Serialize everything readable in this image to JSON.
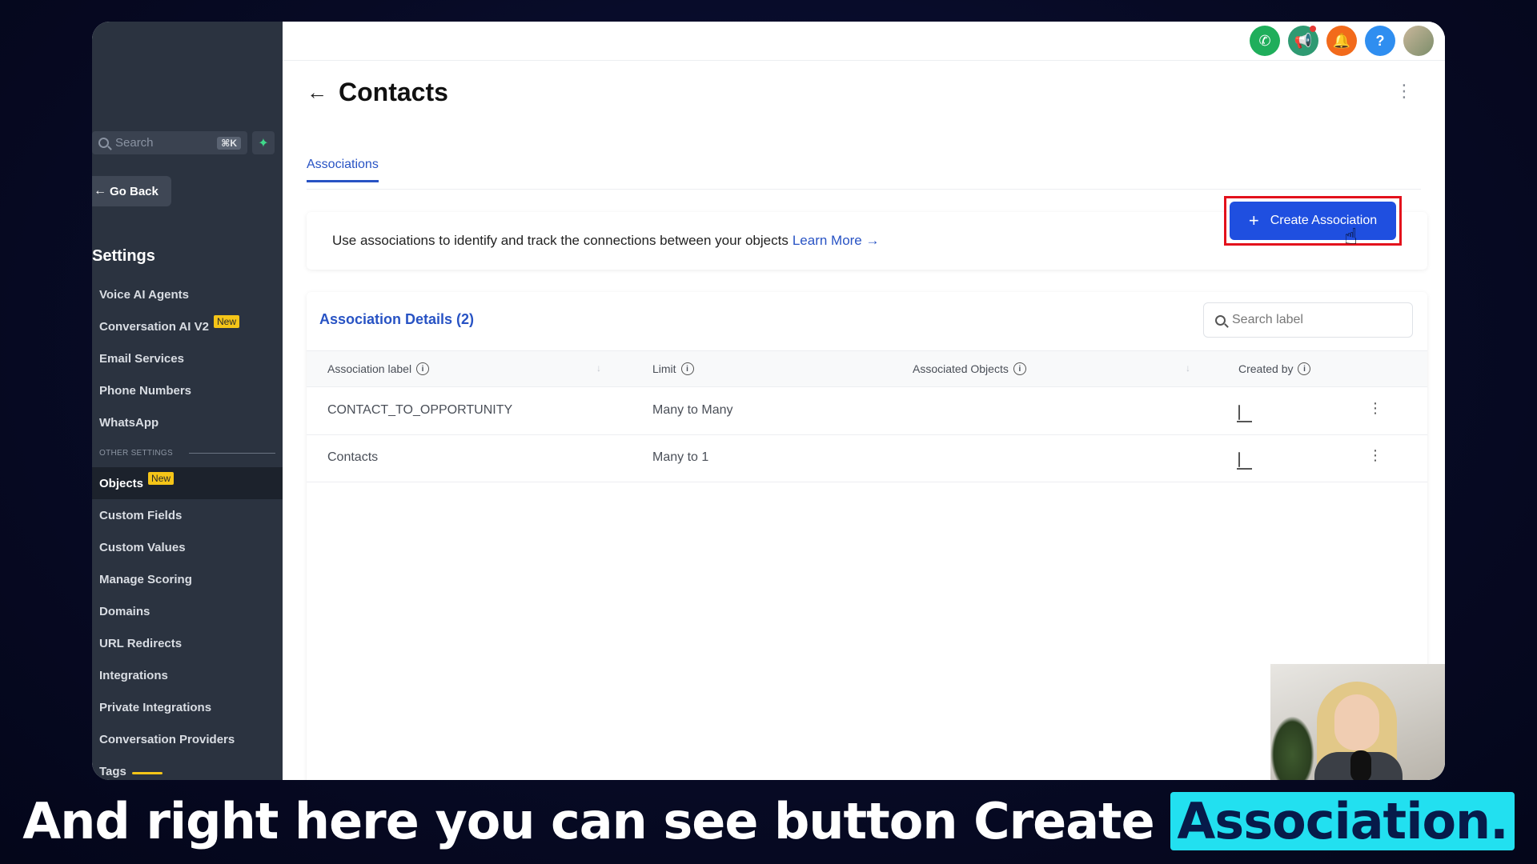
{
  "sidebar": {
    "search_placeholder": "Search",
    "search_shortcut": "⌘K",
    "go_back": "Go Back",
    "title": "Settings",
    "items": [
      {
        "label": "Voice AI Agents",
        "badge": ""
      },
      {
        "label": "Conversation AI V2",
        "badge": "New"
      },
      {
        "label": "Email Services",
        "badge": ""
      },
      {
        "label": "Phone Numbers",
        "badge": ""
      },
      {
        "label": "WhatsApp",
        "badge": ""
      }
    ],
    "section_label": "OTHER SETTINGS",
    "other_items": [
      {
        "label": "Objects",
        "badge": "New",
        "active": true
      },
      {
        "label": "Custom Fields",
        "badge": ""
      },
      {
        "label": "Custom Values",
        "badge": ""
      },
      {
        "label": "Manage Scoring",
        "badge": ""
      },
      {
        "label": "Domains",
        "badge": ""
      },
      {
        "label": "URL Redirects",
        "badge": ""
      },
      {
        "label": "Integrations",
        "badge": ""
      },
      {
        "label": "Private Integrations",
        "badge": ""
      },
      {
        "label": "Conversation Providers",
        "badge": ""
      },
      {
        "label": "Tags",
        "badge": ""
      }
    ]
  },
  "topbar": {
    "icons": [
      "phone-icon",
      "megaphone-icon",
      "bell-icon",
      "help-icon",
      "user-avatar"
    ],
    "help_glyph": "?"
  },
  "page": {
    "title": "Contacts",
    "tab": "Associations",
    "info_text": "Use associations to identify and track the connections between your objects",
    "learn_more": "Learn More",
    "create_button": "Create Association"
  },
  "table": {
    "title": "Association Details (2)",
    "search_placeholder": "Search label",
    "headers": [
      "Association label",
      "Limit",
      "Associated Objects",
      "Created by"
    ],
    "rows": [
      {
        "label": "CONTACT_TO_OPPORTUNITY",
        "limit": "Many to Many",
        "associated": "",
        "created_by": "system-icon"
      },
      {
        "label": "Contacts",
        "limit": "Many to 1",
        "associated": "",
        "created_by": "system-icon"
      }
    ]
  },
  "caption": {
    "text": "And right here you can see button Create",
    "highlight": "Association."
  },
  "colors": {
    "accent": "#1f4fe0",
    "highlight_box": "#e3111c",
    "caption_highlight": "#22e0f0",
    "sidebar_bg": "#2b3340"
  }
}
